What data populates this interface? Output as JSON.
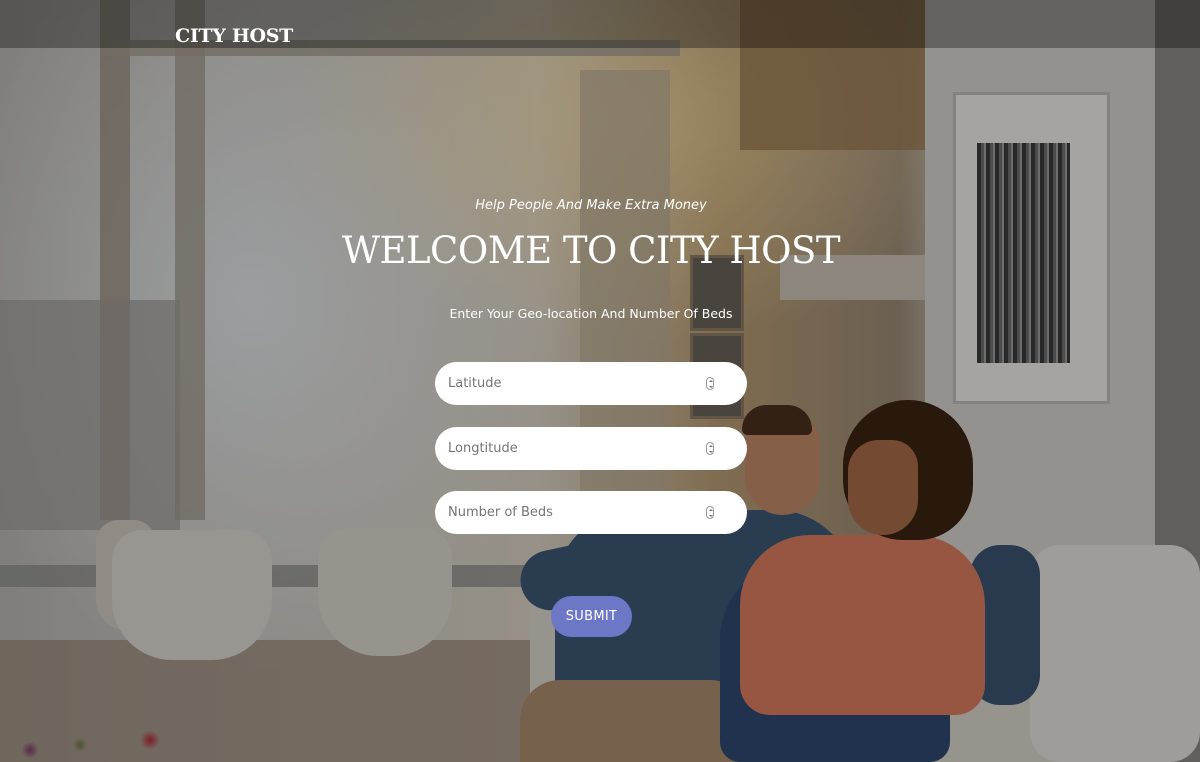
{
  "header": {
    "brand": "CITY HOST"
  },
  "hero": {
    "tagline": "Help People And Make Extra Money",
    "title": "WELCOME TO CITY HOST",
    "instruction": "Enter Your Geo-location And Number Of Beds"
  },
  "form": {
    "latitude": {
      "placeholder": "Latitude",
      "value": ""
    },
    "longitude": {
      "placeholder": "Longtitude",
      "value": ""
    },
    "beds": {
      "placeholder": "Number of Beds",
      "value": ""
    },
    "submit_label": "SUBMIT"
  },
  "colors": {
    "submit_button": "#6c78c6",
    "field_background": "#ffffff",
    "text": "#ffffff"
  },
  "icons": {
    "field_stepper": "spinner-arrows-icon"
  }
}
